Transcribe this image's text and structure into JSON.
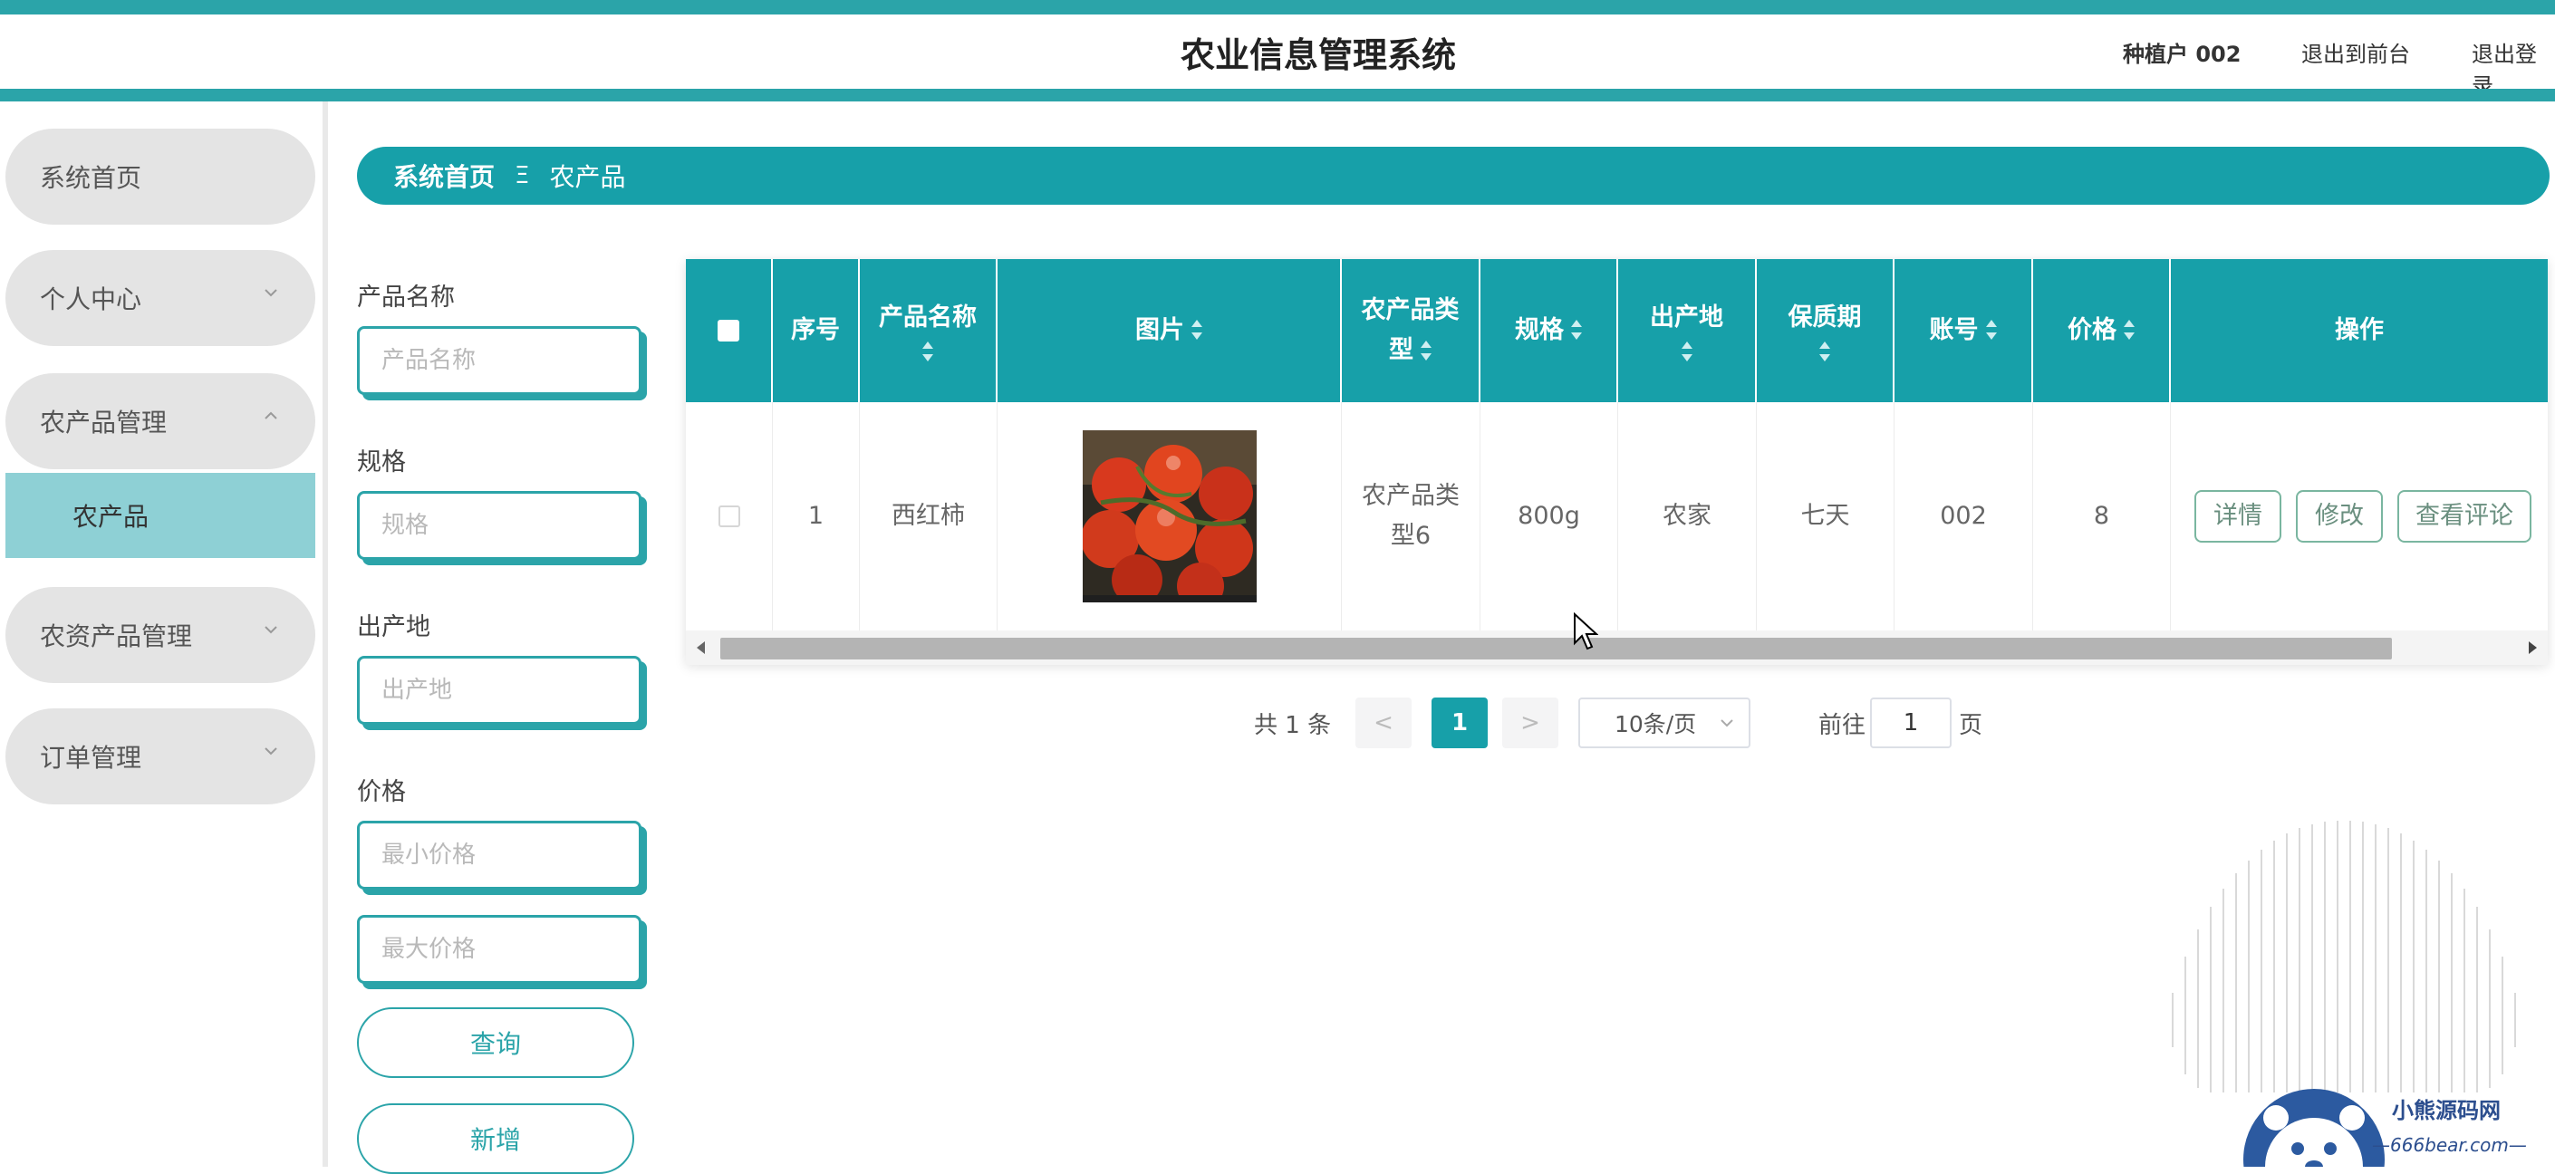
{
  "header": {
    "title": "农业信息管理系统",
    "user": "种植户 002",
    "back_to_front": "退出到前台",
    "logout": "退出登录"
  },
  "sidebar": {
    "items": [
      {
        "label": "系统首页"
      },
      {
        "label": "个人中心"
      },
      {
        "label": "农产品管理"
      },
      {
        "label": "农资产品管理"
      },
      {
        "label": "订单管理"
      }
    ],
    "active_sub": "农产品"
  },
  "breadcrumb": {
    "home": "系统首页",
    "separator": "Ξ",
    "current": "农产品"
  },
  "search": {
    "name_label": "产品名称",
    "name_placeholder": "产品名称",
    "spec_label": "规格",
    "spec_placeholder": "规格",
    "origin_label": "出产地",
    "origin_placeholder": "出产地",
    "price_label": "价格",
    "min_placeholder": "最小价格",
    "max_placeholder": "最大价格",
    "query_button": "查询",
    "add_button": "新增"
  },
  "table": {
    "headers": {
      "index": "序号",
      "name": "产品名称",
      "image": "图片",
      "type_a": "农产品类",
      "type_b": "型",
      "spec": "规格",
      "origin": "出产地",
      "shelf": "保质期",
      "account": "账号",
      "price": "价格",
      "ops": "操作"
    },
    "rows": [
      {
        "index": "1",
        "name": "西红柿",
        "image": "tomato-photo",
        "type_a": "农产品类",
        "type_b": "型6",
        "spec": "800g",
        "origin": "农家",
        "shelf": "七天",
        "account": "002",
        "price": "8"
      }
    ],
    "actions": {
      "detail": "详情",
      "edit": "修改",
      "comments": "查看评论"
    }
  },
  "pagination": {
    "total": "共 1 条",
    "prev": "<",
    "current": "1",
    "next": ">",
    "page_size": "10条/页",
    "goto": "前往",
    "jump_value": "1",
    "page_unit": "页"
  },
  "watermark": {
    "name": "小熊源码网",
    "site": "—666bear.com—"
  },
  "colors": {
    "primary": "#17a0a9",
    "accent": "#2ba4a9",
    "menu_bg": "#e4e4e4",
    "active_sub": "#8ed0d5"
  }
}
